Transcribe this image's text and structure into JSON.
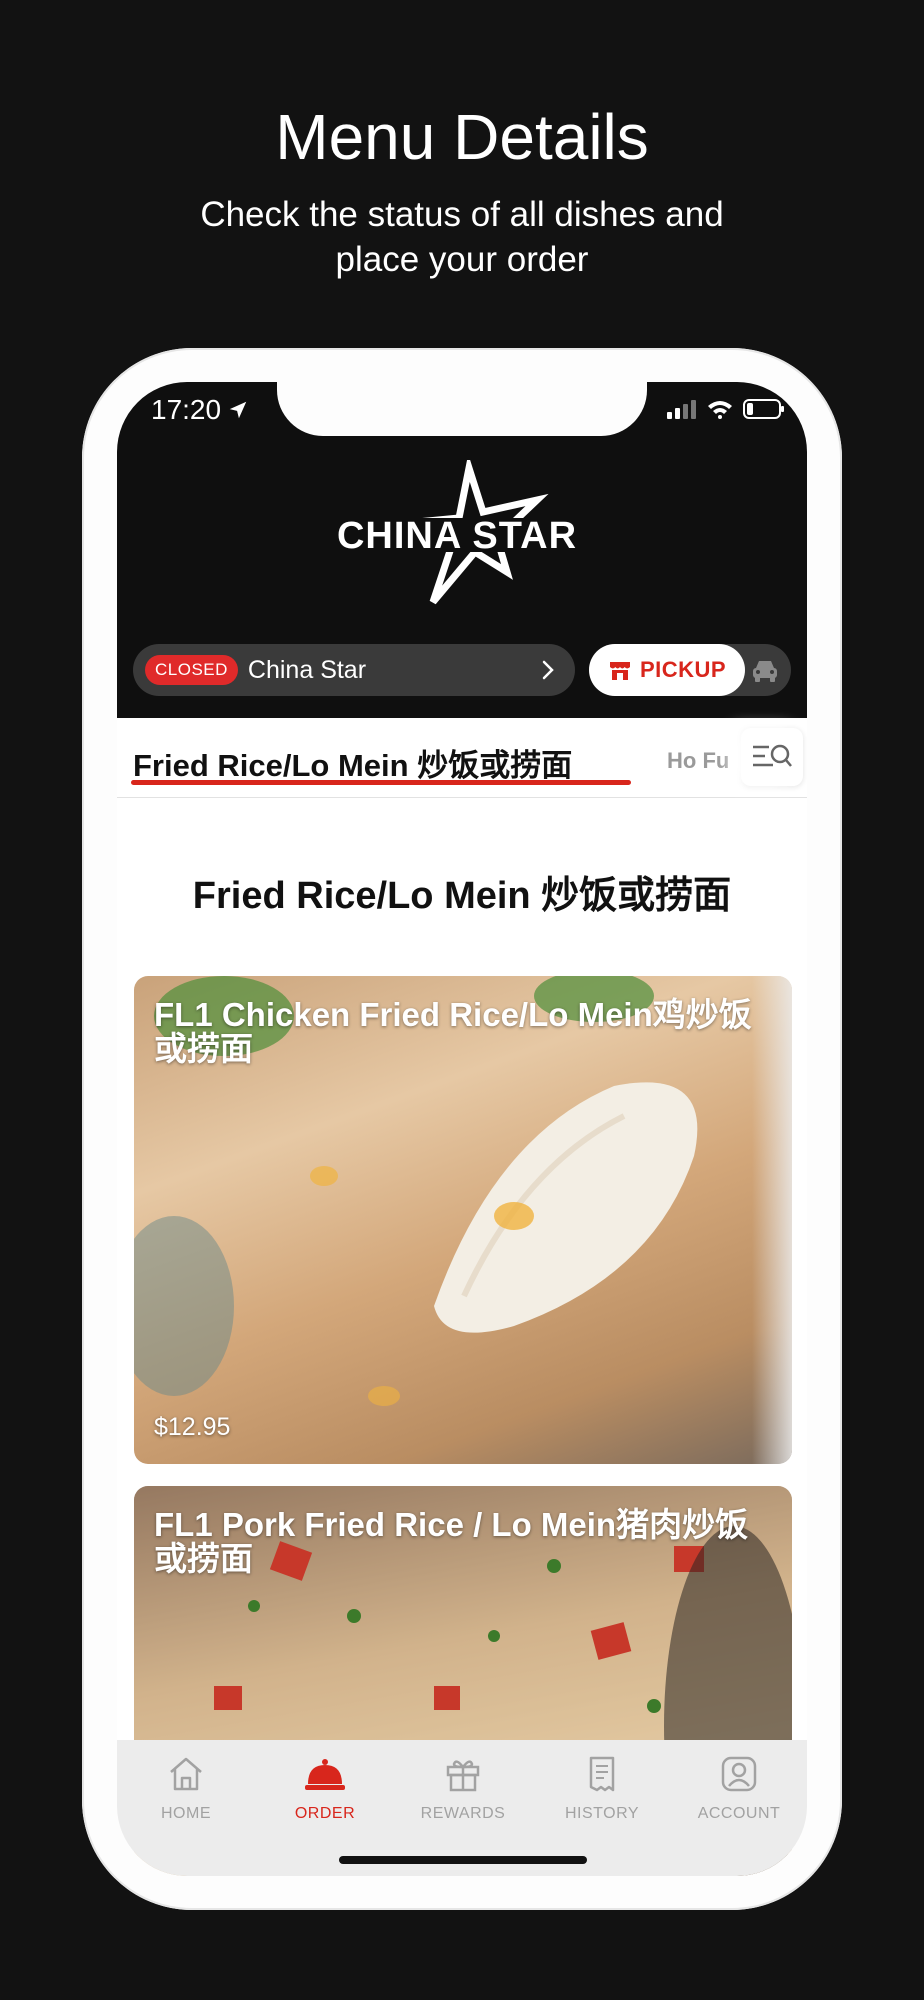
{
  "promo": {
    "title": "Menu Details",
    "subtitle": "Check the status of all dishes and place your order"
  },
  "status_bar": {
    "time": "17:20"
  },
  "brand": {
    "logo_text": "CHINA STAR"
  },
  "store": {
    "status_badge": "CLOSED",
    "name": "China Star"
  },
  "order_mode": {
    "pickup_label": "PICKUP"
  },
  "categories": {
    "active": "Fried Rice/Lo Mein 炒饭或捞面",
    "next": "Ho Fu"
  },
  "section": {
    "title": "Fried Rice/Lo Mein 炒饭或捞面"
  },
  "menu_items": [
    {
      "title": "FL1 Chicken Fried Rice/Lo Mein鸡炒饭或捞面",
      "price": "$12.95"
    },
    {
      "title": "FL1 Pork Fried Rice / Lo Mein猪肉炒饭或捞面"
    }
  ],
  "tabbar": {
    "items": [
      {
        "label": "HOME",
        "icon": "home-icon"
      },
      {
        "label": "ORDER",
        "icon": "cloche-icon",
        "active": true
      },
      {
        "label": "REWARDS",
        "icon": "gift-icon"
      },
      {
        "label": "HISTORY",
        "icon": "receipt-icon"
      },
      {
        "label": "ACCOUNT",
        "icon": "account-icon"
      }
    ]
  },
  "colors": {
    "accent": "#d8261c",
    "background": "#121212",
    "header": "#0f0f0f",
    "closed_badge": "#e02a2a"
  }
}
